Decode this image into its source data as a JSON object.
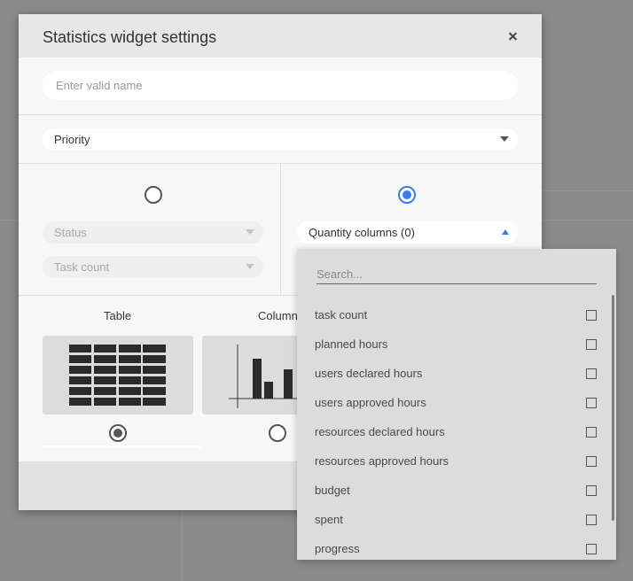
{
  "modal": {
    "title": "Statistics widget settings",
    "name_placeholder": "Enter valid name",
    "group_select": "Priority",
    "left_option": {
      "field1": "Status",
      "field2": "Task count",
      "selected": false
    },
    "right_option": {
      "field": "Quantity columns (0)",
      "selected": true
    },
    "chart_types": [
      {
        "label": "Table",
        "selected": true
      },
      {
        "label": "Column",
        "selected": false
      }
    ]
  },
  "dropdown": {
    "search_placeholder": "Search...",
    "items": [
      {
        "label": "task count",
        "checked": false
      },
      {
        "label": "planned hours",
        "checked": false
      },
      {
        "label": "users declared hours",
        "checked": false
      },
      {
        "label": "users approved hours",
        "checked": false
      },
      {
        "label": "resources declared hours",
        "checked": false
      },
      {
        "label": "resources approved hours",
        "checked": false
      },
      {
        "label": "budget",
        "checked": false
      },
      {
        "label": "spent",
        "checked": false
      },
      {
        "label": "progress",
        "checked": false
      }
    ]
  },
  "colors": {
    "accent": "#3b7bf2",
    "overlay": "#8b8b8b"
  }
}
